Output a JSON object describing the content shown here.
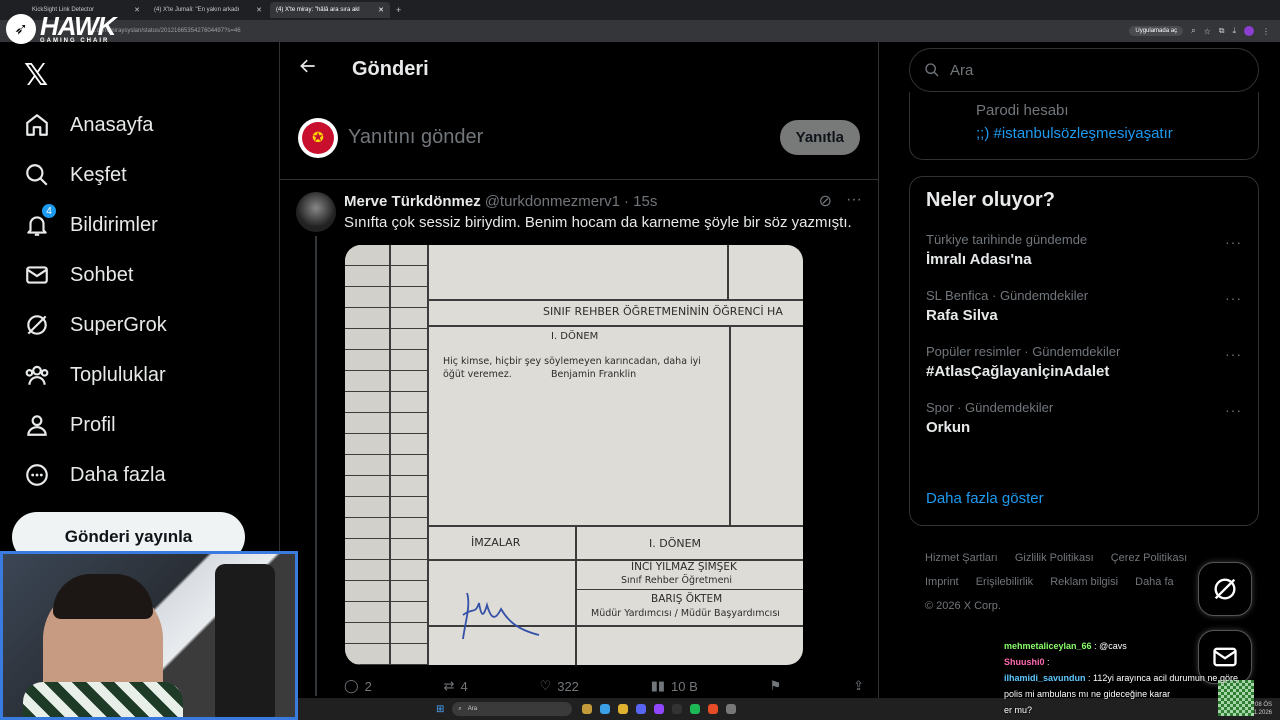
{
  "browser": {
    "tabs": [
      {
        "title": "KickSight Link Detector",
        "active": false
      },
      {
        "title": "(4) X'te Jumali: \"En yakın arkadı",
        "active": false
      },
      {
        "title": "(4) X'te miray: \"hâlâ ara sıra akl",
        "active": true
      }
    ],
    "url": "x.com/miraysyslan/status/2012166535427604497?s=46",
    "app_button": "Uygulamada aç"
  },
  "overlay": {
    "logo_text": "HAWK",
    "logo_sub": "GAMING CHAIR"
  },
  "nav": {
    "items": [
      {
        "label": "Anasayfa",
        "icon": "home-icon"
      },
      {
        "label": "Keşfet",
        "icon": "search-icon"
      },
      {
        "label": "Bildirimler",
        "icon": "bell-icon",
        "badge": "4"
      },
      {
        "label": "Sohbet",
        "icon": "mail-icon"
      },
      {
        "label": "SuperGrok",
        "icon": "grok-icon"
      },
      {
        "label": "Topluluklar",
        "icon": "people-icon"
      },
      {
        "label": "Profil",
        "icon": "person-icon"
      },
      {
        "label": "Daha fazla",
        "icon": "more-circle-icon"
      }
    ],
    "post_button": "Gönderi yayınla"
  },
  "main": {
    "title": "Gönderi",
    "reply_placeholder": "Yanıtını gönder",
    "reply_button": "Yanıtla",
    "tweet": {
      "name": "Merve Türkdönmez",
      "handle": "@turkdonmezmerv1",
      "time": "· 15s",
      "text": "Sınıfta çok sessiz biriydim. Benim hocam da karneme şöyle bir söz yazmıştı.",
      "image": {
        "header": "SINIF REHBER ÖĞRETMENİNİN ÖĞRENCİ HA",
        "term": "I. DÖNEM",
        "quote_line1": "Hiç kimse, hiçbir şey söylemeyen karıncadan, daha iyi",
        "quote_line2": "öğüt veremez.",
        "quote_author": "Benjamin Franklin",
        "signatures_label": "İMZALAR",
        "term2": "I. DÖNEM",
        "teacher_name": "İNCİ YILMAZ ŞİMŞEK",
        "teacher_role": "Sınıf Rehber Öğretmeni",
        "principal_name": "BARIŞ ÖKTEM",
        "principal_role": "Müdür Yardımcısı / Müdür Başyardımcısı"
      },
      "stats": {
        "replies": "2",
        "reposts": "4",
        "likes": "322",
        "views": "10 B"
      }
    }
  },
  "right": {
    "search_placeholder": "Ara",
    "prev_card_line1": "Parodi hesabı",
    "prev_card_line2": ";;) #istanbulsözleşmesiyaşatır",
    "trends_title": "Neler oluyor?",
    "trends": [
      {
        "context": "Türkiye tarihinde gündemde",
        "name": "İmralı Adası'na"
      },
      {
        "context": "SL Benfica · Gündemdekiler",
        "name": "Rafa Silva"
      },
      {
        "context": "Popüler resimler · Gündemdekiler",
        "name": "#AtlasÇağlayanİçinAdalet"
      },
      {
        "context": "Spor · Gündemdekiler",
        "name": "Orkun"
      }
    ],
    "show_more": "Daha fazla göster",
    "footer": {
      "l1": "Hizmet Şartları",
      "l2": "Gizlilik Politikası",
      "l3": "Çerez Politikası",
      "l4": "Imprint",
      "l5": "Erişilebilirlik",
      "l6": "Reklam bilgisi",
      "l7": "Daha fa",
      "copyright": "© 2026 X Corp."
    }
  },
  "chat": [
    {
      "user": "mehmetaliceylan_66",
      "message": ": @cavs"
    },
    {
      "user": "Shuushi0",
      "message": ":"
    },
    {
      "user": "ilhamidi_savundun",
      "message": ": 112yi arayınca acil durumun ne göre polis mi ambulans mı ne gideceğine karar"
    },
    {
      "user": "",
      "message": "er mu?"
    }
  ],
  "taskbar": {
    "search": "Ara",
    "time": "10:08 ÖS",
    "date": "17.01.2026"
  }
}
